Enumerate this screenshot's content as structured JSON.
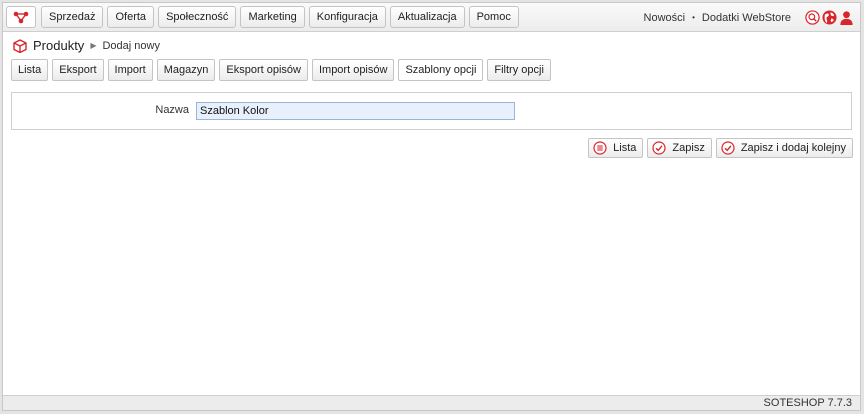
{
  "topnav": {
    "items": [
      "Sprzedaż",
      "Oferta",
      "Społeczność",
      "Marketing",
      "Konfiguracja",
      "Aktualizacja",
      "Pomoc"
    ]
  },
  "topright": {
    "news": "Nowości",
    "separator": "•",
    "webstore": "Dodatki WebStore",
    "icons": [
      "search-icon",
      "globe-icon",
      "user-icon"
    ]
  },
  "breadcrumb": {
    "title": "Produkty",
    "arrow": "▶",
    "current": "Dodaj nowy"
  },
  "tabs": {
    "items": [
      "Lista",
      "Eksport",
      "Import",
      "Magazyn",
      "Eksport opisów",
      "Import opisów",
      "Szablony opcji",
      "Filtry opcji"
    ],
    "active": "Szablony opcji"
  },
  "form": {
    "name_label": "Nazwa",
    "name_value": "Szablon Kolor"
  },
  "actions": {
    "list_label": "Lista",
    "save_label": "Zapisz",
    "save_add_label": "Zapisz i dodaj kolejny"
  },
  "footer": {
    "version": "SOTESHOP 7.7.3"
  },
  "colors": {
    "accent": "#d9262c"
  }
}
